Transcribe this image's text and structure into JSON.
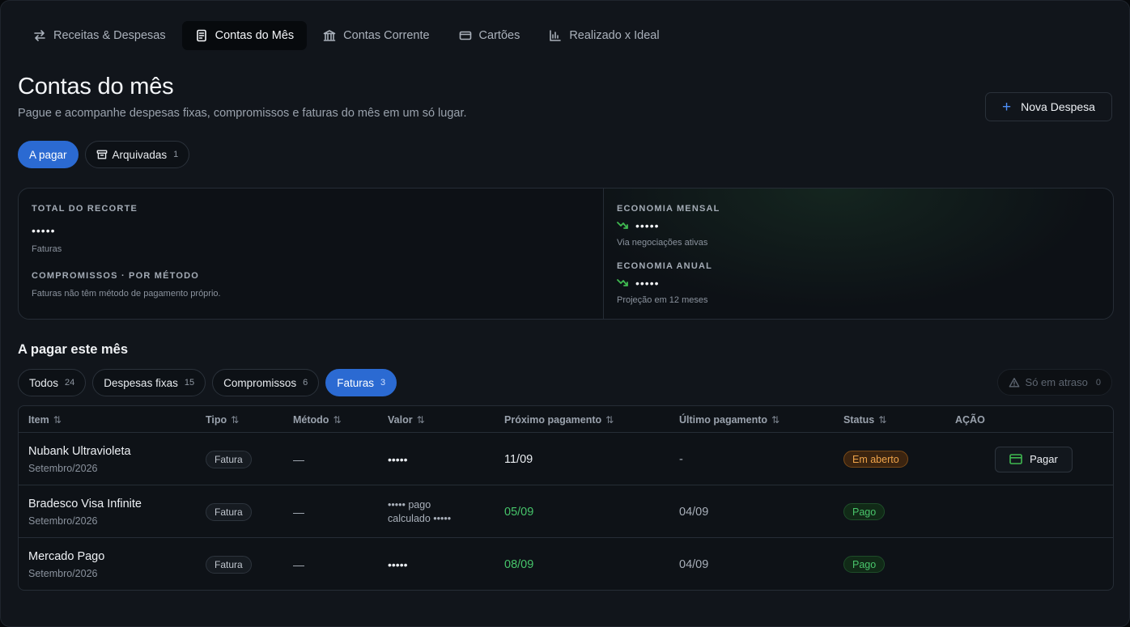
{
  "nav": {
    "tabs": [
      {
        "label": "Receitas & Despesas",
        "icon": "arrows-swap-icon"
      },
      {
        "label": "Contas do Mês",
        "icon": "document-icon",
        "active": true
      },
      {
        "label": "Contas Corrente",
        "icon": "bank-icon"
      },
      {
        "label": "Cartões",
        "icon": "credit-card-icon"
      },
      {
        "label": "Realizado x Ideal",
        "icon": "bar-chart-icon"
      }
    ]
  },
  "header": {
    "title": "Contas do mês",
    "subtitle": "Pague e acompanhe despesas fixas, compromissos e faturas do mês em um só lugar.",
    "new_button": "Nova Despesa"
  },
  "view_tabs": {
    "to_pay": "A pagar",
    "archived": "Arquivadas",
    "archived_count": "1"
  },
  "summary": {
    "total_label": "TOTAL DO RECORTE",
    "total_value": "•••••",
    "total_sub": "Faturas",
    "commit_label": "COMPROMISSOS · POR MÉTODO",
    "commit_note": "Faturas não têm método de pagamento próprio.",
    "monthly_label": "ECONOMIA MENSAL",
    "monthly_value": "•••••",
    "monthly_sub": "Via negociações ativas",
    "annual_label": "ECONOMIA ANUAL",
    "annual_value": "•••••",
    "annual_sub": "Projeção em 12 meses"
  },
  "section_title": "A pagar este mês",
  "filters": [
    {
      "label": "Todos",
      "count": "24"
    },
    {
      "label": "Despesas fixas",
      "count": "15"
    },
    {
      "label": "Compromissos",
      "count": "6"
    },
    {
      "label": "Faturas",
      "count": "3",
      "active": true
    }
  ],
  "late_filter": {
    "label": "Só em atraso",
    "count": "0"
  },
  "table": {
    "headers": {
      "item": "Item",
      "tipo": "Tipo",
      "metodo": "Método",
      "valor": "Valor",
      "proximo": "Próximo pagamento",
      "ultimo": "Último pagamento",
      "status": "Status",
      "acao": "AÇÃO"
    },
    "sort_glyph": "⇅",
    "rows": [
      {
        "name": "Nubank Ultravioleta",
        "sub": "Setembro/2026",
        "tipo": "Fatura",
        "metodo": "—",
        "valor": "•••••",
        "valor2": "",
        "proximo": "11/09",
        "ultimo": "-",
        "status": "Em aberto",
        "action": "Pagar"
      },
      {
        "name": "Bradesco Visa Infinite",
        "sub": "Setembro/2026",
        "tipo": "Fatura",
        "metodo": "—",
        "valor": "••••• pago",
        "valor2": "calculado •••••",
        "proximo": "05/09",
        "ultimo": "04/09",
        "status": "Pago",
        "action": ""
      },
      {
        "name": "Mercado Pago",
        "sub": "Setembro/2026",
        "tipo": "Fatura",
        "metodo": "—",
        "valor": "•••••",
        "valor2": "",
        "proximo": "08/09",
        "ultimo": "04/09",
        "status": "Pago",
        "action": ""
      }
    ]
  },
  "colors": {
    "accent_blue": "#2b6ad2",
    "positive_green": "#46c46a",
    "warning_orange": "#f0a44a"
  }
}
